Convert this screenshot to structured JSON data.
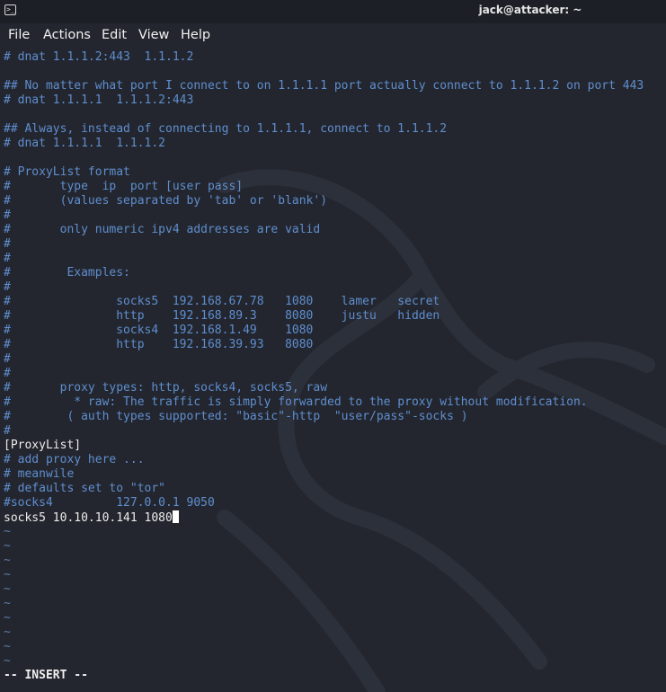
{
  "window": {
    "title": "jack@attacker: ~",
    "icon": "terminal-icon"
  },
  "menu": [
    "File",
    "Actions",
    "Edit",
    "View",
    "Help"
  ],
  "editor": {
    "lines": [
      {
        "text": "# dnat 1.1.1.2:443  1.1.1.2",
        "kind": "c"
      },
      {
        "text": "",
        "kind": "c"
      },
      {
        "text": "## No matter what port I connect to on 1.1.1.1 port actually connect to 1.1.1.2 on port 443",
        "kind": "c"
      },
      {
        "text": "# dnat 1.1.1.1  1.1.1.2:443",
        "kind": "c"
      },
      {
        "text": "",
        "kind": "c"
      },
      {
        "text": "## Always, instead of connecting to 1.1.1.1, connect to 1.1.1.2",
        "kind": "c"
      },
      {
        "text": "# dnat 1.1.1.1  1.1.1.2",
        "kind": "c"
      },
      {
        "text": "",
        "kind": "c"
      },
      {
        "text": "# ProxyList format",
        "kind": "c"
      },
      {
        "text": "#       type  ip  port [user pass]",
        "kind": "c"
      },
      {
        "text": "#       (values separated by 'tab' or 'blank')",
        "kind": "c"
      },
      {
        "text": "#",
        "kind": "c"
      },
      {
        "text": "#       only numeric ipv4 addresses are valid",
        "kind": "c"
      },
      {
        "text": "#",
        "kind": "c"
      },
      {
        "text": "#",
        "kind": "c"
      },
      {
        "text": "#        Examples:",
        "kind": "c"
      },
      {
        "text": "#",
        "kind": "c"
      },
      {
        "text": "#               socks5  192.168.67.78   1080    lamer   secret",
        "kind": "c"
      },
      {
        "text": "#               http    192.168.89.3    8080    justu   hidden",
        "kind": "c"
      },
      {
        "text": "#               socks4  192.168.1.49    1080",
        "kind": "c"
      },
      {
        "text": "#               http    192.168.39.93   8080",
        "kind": "c"
      },
      {
        "text": "#",
        "kind": "c"
      },
      {
        "text": "#",
        "kind": "c"
      },
      {
        "text": "#       proxy types: http, socks4, socks5, raw",
        "kind": "c"
      },
      {
        "text": "#         * raw: The traffic is simply forwarded to the proxy without modification.",
        "kind": "c"
      },
      {
        "text": "#        ( auth types supported: \"basic\"-http  \"user/pass\"-socks )",
        "kind": "c"
      },
      {
        "text": "#",
        "kind": "c"
      },
      {
        "text": "[ProxyList]",
        "kind": "t"
      },
      {
        "text": "# add proxy here ...",
        "kind": "c"
      },
      {
        "text": "# meanwile",
        "kind": "c"
      },
      {
        "text": "# defaults set to \"tor\"",
        "kind": "c"
      },
      {
        "text": "#socks4         127.0.0.1 9050",
        "kind": "c"
      },
      {
        "text": "socks5 10.10.10.141 1080",
        "kind": "t",
        "cursor": true
      },
      {
        "text": "~",
        "kind": "tilde"
      },
      {
        "text": "~",
        "kind": "tilde"
      },
      {
        "text": "~",
        "kind": "tilde"
      },
      {
        "text": "~",
        "kind": "tilde"
      },
      {
        "text": "~",
        "kind": "tilde"
      },
      {
        "text": "~",
        "kind": "tilde"
      },
      {
        "text": "~",
        "kind": "tilde"
      },
      {
        "text": "~",
        "kind": "tilde"
      },
      {
        "text": "~",
        "kind": "tilde"
      },
      {
        "text": "~",
        "kind": "tilde"
      }
    ],
    "mode": "-- INSERT --"
  },
  "colors": {
    "background": "#23262e",
    "comment": "#5f8ecf",
    "text": "#ececec",
    "tilde": "#5e7ca8"
  }
}
